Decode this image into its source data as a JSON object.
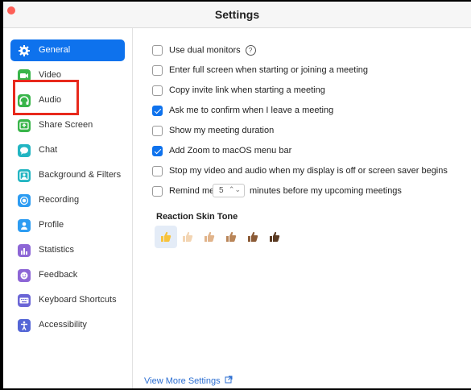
{
  "window": {
    "title": "Settings"
  },
  "sidebar": {
    "items": [
      {
        "label": "General",
        "icon": "gear-icon",
        "color": "#ffffff",
        "active": true
      },
      {
        "label": "Video",
        "icon": "video-icon",
        "color": "#39b54a"
      },
      {
        "label": "Audio",
        "icon": "headphones-icon",
        "color": "#39b54a"
      },
      {
        "label": "Share Screen",
        "icon": "share-screen-icon",
        "color": "#39b54a"
      },
      {
        "label": "Chat",
        "icon": "chat-icon",
        "color": "#22b5c2"
      },
      {
        "label": "Background & Filters",
        "icon": "background-icon",
        "color": "#22b5c2"
      },
      {
        "label": "Recording",
        "icon": "recording-icon",
        "color": "#2d9cf2"
      },
      {
        "label": "Profile",
        "icon": "profile-icon",
        "color": "#2d9cf2"
      },
      {
        "label": "Statistics",
        "icon": "statistics-icon",
        "color": "#8d66d6"
      },
      {
        "label": "Feedback",
        "icon": "feedback-icon",
        "color": "#8d66d6"
      },
      {
        "label": "Keyboard Shortcuts",
        "icon": "keyboard-icon",
        "color": "#6b66d6"
      },
      {
        "label": "Accessibility",
        "icon": "accessibility-icon",
        "color": "#5466d6"
      }
    ]
  },
  "general": {
    "options": [
      {
        "label": "Use dual monitors",
        "checked": false,
        "help": true
      },
      {
        "label": "Enter full screen when starting or joining a meeting",
        "checked": false
      },
      {
        "label": "Copy invite link when starting a meeting",
        "checked": false
      },
      {
        "label": "Ask me to confirm when I leave a meeting",
        "checked": true
      },
      {
        "label": "Show my meeting duration",
        "checked": false
      },
      {
        "label": "Add Zoom to macOS menu bar",
        "checked": true
      },
      {
        "label": "Stop my video and audio when my display is off or screen saver begins",
        "checked": false
      }
    ],
    "remind": {
      "before": "Remind me",
      "value": "5",
      "after": "minutes before my upcoming meetings",
      "checked": false
    },
    "skin_tone": {
      "title": "Reaction Skin Tone",
      "tones": [
        "#f7c23a",
        "#f3d5b3",
        "#e1b48b",
        "#b98558",
        "#8a5a35",
        "#5a3a22"
      ],
      "selected": 0
    },
    "more_link": "View More Settings"
  },
  "accent": "#0e72ed",
  "annotation_color": "#e8291c"
}
